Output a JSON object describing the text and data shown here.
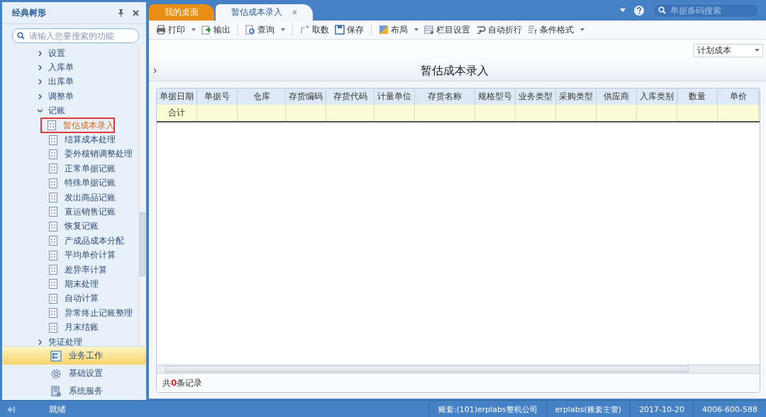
{
  "sidebar": {
    "title": "经典树形",
    "search": {
      "placeholder": "请输入您要搜索的功能"
    },
    "tree": [
      {
        "label": "设置",
        "expanded": false
      },
      {
        "label": "入库单",
        "expanded": false
      },
      {
        "label": "出库单",
        "expanded": false
      },
      {
        "label": "调整单",
        "expanded": false
      },
      {
        "label": "记账",
        "expanded": true,
        "children": [
          {
            "label": "暂估成本录入",
            "selected": true
          },
          {
            "label": "结算成本处理",
            "selected": false
          },
          {
            "label": "委外核销调整处理",
            "selected": false
          },
          {
            "label": "正常单据记账",
            "selected": false
          },
          {
            "label": "特殊单据记账",
            "selected": false
          },
          {
            "label": "发出商品记账",
            "selected": false
          },
          {
            "label": "直运销售记账",
            "selected": false
          },
          {
            "label": "恢复记账",
            "selected": false
          },
          {
            "label": "产成品成本分配",
            "selected": false
          },
          {
            "label": "平均单价计算",
            "selected": false
          },
          {
            "label": "差异率计算",
            "selected": false
          },
          {
            "label": "期末处理",
            "selected": false
          },
          {
            "label": "自动计算",
            "selected": false
          },
          {
            "label": "异常终止记账整理",
            "selected": false
          },
          {
            "label": "月末结账",
            "selected": false
          }
        ]
      },
      {
        "label": "凭证处理",
        "expanded": false
      }
    ],
    "nav": [
      {
        "label": "业务工作",
        "selected": true
      },
      {
        "label": "基础设置",
        "selected": false
      },
      {
        "label": "系统服务",
        "selected": false
      }
    ]
  },
  "tabs": [
    {
      "label": "我的桌面",
      "selected": false,
      "closable": false
    },
    {
      "label": "暂估成本录入",
      "selected": true,
      "closable": true
    }
  ],
  "top_search": {
    "placeholder": "单据条码搜索"
  },
  "toolbar_groups": [
    [
      {
        "label": "打印",
        "menu": true
      },
      {
        "label": "输出",
        "menu": false
      }
    ],
    [
      {
        "label": "查询",
        "menu": true
      }
    ],
    [
      {
        "label": "取数",
        "menu": false
      },
      {
        "label": "保存",
        "menu": false
      }
    ],
    [
      {
        "label": "布局",
        "menu": true
      },
      {
        "label": "栏目设置",
        "menu": false
      },
      {
        "label": "自动折行",
        "menu": false
      },
      {
        "label": "条件格式",
        "menu": true
      }
    ]
  ],
  "cost_type": {
    "value": "计划成本"
  },
  "page_title": "暂估成本录入",
  "table": {
    "columns": [
      "单据日期",
      "单据号",
      "仓库",
      "存货编码",
      "存货代码",
      "计量单位",
      "存货名称",
      "规格型号",
      "业务类型",
      "采购类型",
      "供应商",
      "入库类别",
      "数量",
      "单价"
    ],
    "summary_label": "合计"
  },
  "record_count": {
    "prefix": "共",
    "count": "0",
    "suffix": "条记录"
  },
  "status_bar": {
    "state": "就绪",
    "cells": [
      "账套:(101)erplabs整机公司",
      "erplabs(账套主管)",
      "2017-10-20",
      "4006-600-588"
    ]
  }
}
